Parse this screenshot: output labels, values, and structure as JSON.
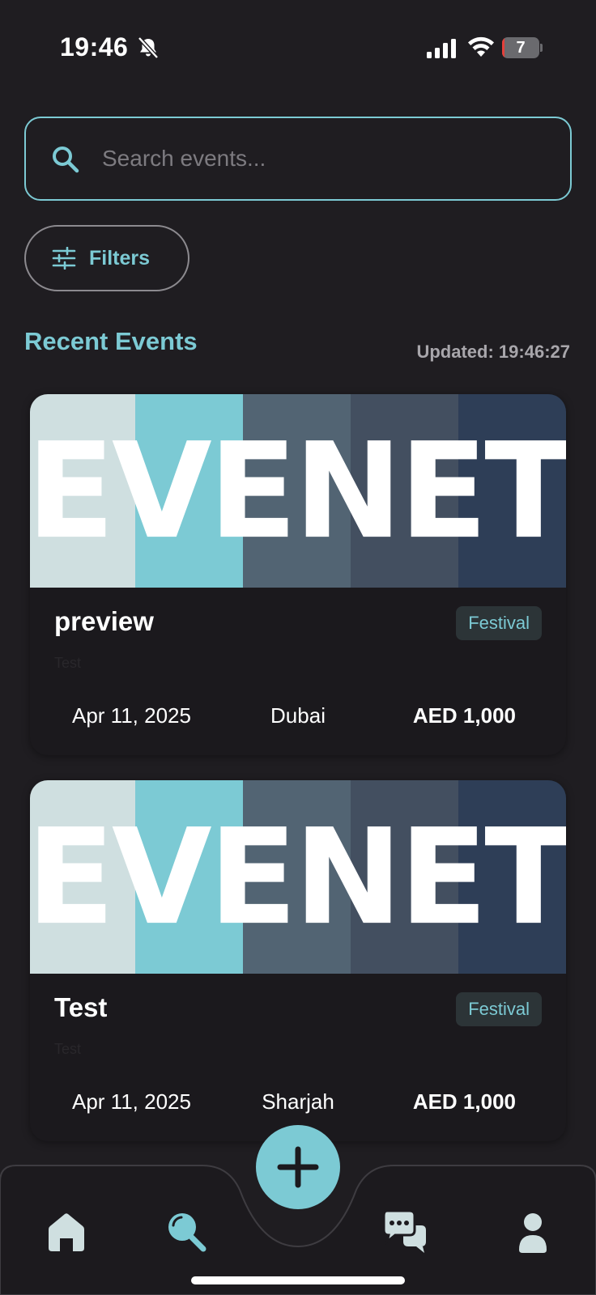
{
  "status_bar": {
    "time": "19:46",
    "battery_level": "7",
    "battery_fraction": 0.07
  },
  "search": {
    "placeholder": "Search events...",
    "value": ""
  },
  "filters": {
    "label": "Filters"
  },
  "section": {
    "title": "Recent Events",
    "updated": "Updated: 19:46:27"
  },
  "colors": {
    "accent": "#7ccad4",
    "background": "#1f1d21",
    "card": "#1b191d",
    "badge_bg": "#2c3437",
    "banner_stripes": [
      "#cfdfe0",
      "#7ccad4",
      "#526473",
      "#434f60",
      "#2e3e57"
    ]
  },
  "events": [
    {
      "banner_text": "EVENET",
      "title": "preview",
      "subtitle": "Test",
      "category": "Festival",
      "date": "Apr 11, 2025",
      "location": "Dubai",
      "price": "AED 1,000"
    },
    {
      "banner_text": "EVENET",
      "title": "Test",
      "subtitle": "Test",
      "category": "Festival",
      "date": "Apr 11, 2025",
      "location": "Sharjah",
      "price": "AED 1,000"
    }
  ],
  "nav": {
    "items": [
      {
        "name": "home",
        "icon": "home-icon",
        "active": false
      },
      {
        "name": "search",
        "icon": "search-icon",
        "active": true
      },
      {
        "name": "create",
        "icon": "plus-icon",
        "active": false
      },
      {
        "name": "chat",
        "icon": "chat-bubbles-icon",
        "active": false
      },
      {
        "name": "profile",
        "icon": "person-icon",
        "active": false
      }
    ]
  }
}
